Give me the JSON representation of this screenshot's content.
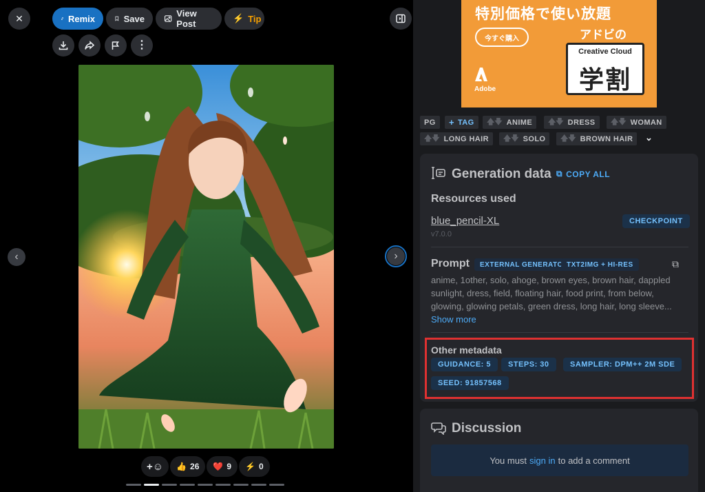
{
  "toolbar": {
    "remix": "Remix",
    "save": "Save",
    "view_post": "View Post",
    "tip": "Tip"
  },
  "reactions": {
    "like_count": "26",
    "heart_count": "9",
    "bolt_count": "0"
  },
  "carousel": {
    "total": 9,
    "active_index": 1
  },
  "ad": {
    "headline": "特別価格で使い放題",
    "cta": "今すぐ購入",
    "brand": "Adobe",
    "tagline": "アドビの",
    "product": "Creative Cloud",
    "big_text": "学割"
  },
  "tags": {
    "rating": "PG",
    "add_tag": "TAG",
    "items": [
      "ANIME",
      "DRESS",
      "WOMAN",
      "LONG HAIR",
      "SOLO",
      "BROWN HAIR"
    ]
  },
  "generation": {
    "title": "Generation data",
    "copy_all": "COPY ALL",
    "resources_title": "Resources used",
    "resource_name": "blue_pencil-XL",
    "resource_version": "v7.0.0",
    "resource_type": "CHECKPOINT",
    "prompt_title": "Prompt",
    "prompt_badges": [
      "EXTERNAL GENERATOR",
      "TXT2IMG + HI-RES"
    ],
    "prompt_lines": [
      "anime, 1other, solo, ahoge, brown eyes, brown hair, dappled",
      "sunlight, dress, field, floating hair, food print, from below,",
      "glowing, glowing petals, green dress, long hair, long sleeve..."
    ],
    "show_more": "Show more",
    "other_title": "Other metadata",
    "metadata": [
      "GUIDANCE: 5",
      "STEPS: 30",
      "SAMPLER: DPM++ 2M SDE",
      "SEED: 91857568"
    ]
  },
  "discussion": {
    "title": "Discussion",
    "prefix": "You must",
    "link": "sign in",
    "suffix": "to add a comment"
  },
  "colors": {
    "accent": "#1971c2",
    "badge_text": "#74c0fc",
    "highlight": "#e03131",
    "ad_bg": "#f29b38"
  }
}
